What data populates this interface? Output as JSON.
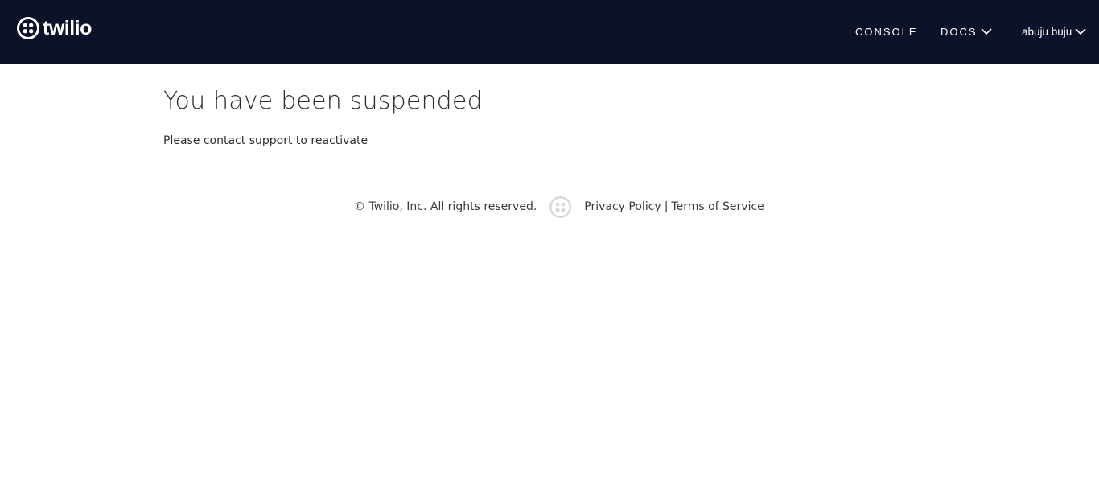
{
  "header": {
    "logo_text": "twilio",
    "nav": {
      "console_label": "CONSOLE",
      "docs_label": "DOCS",
      "user_label": "abuju buju"
    }
  },
  "main": {
    "title": "You have been suspended",
    "message": "Please contact support to reactivate"
  },
  "footer": {
    "copyright": "© Twilio, Inc. All rights reserved.",
    "privacy_label": "Privacy Policy",
    "separator": "|",
    "terms_label": "Terms of Service"
  },
  "colors": {
    "header_bg": "#0d122b",
    "footer_logo": "#d9d9d9"
  },
  "icons": {
    "logo": "twilio-logo-icon",
    "dropdown": "chevron-down-icon",
    "footer_logo": "twilio-footer-logo-icon"
  }
}
